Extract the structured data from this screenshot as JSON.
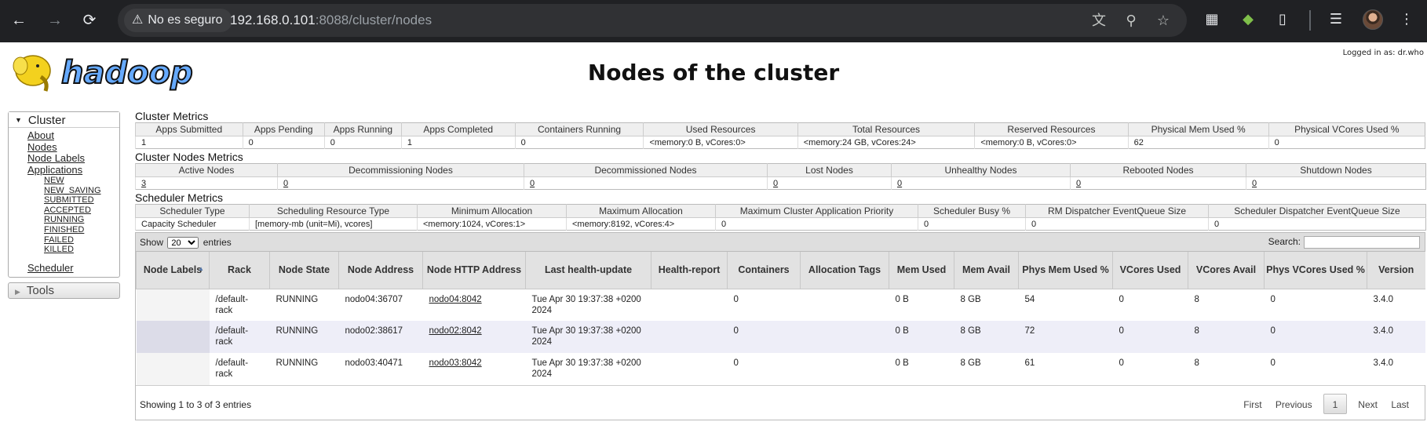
{
  "browser": {
    "security_label": "No es seguro",
    "url_host": "192.168.0.101",
    "url_rest": ":8088/cluster/nodes"
  },
  "header": {
    "logo_text": "hadoop",
    "title": "Nodes of the cluster",
    "logged_in": "Logged in as: dr.who"
  },
  "sidebar": {
    "cluster_label": "Cluster",
    "links": [
      "About",
      "Nodes",
      "Node Labels",
      "Applications"
    ],
    "app_states": [
      "NEW",
      "NEW_SAVING",
      "SUBMITTED",
      "ACCEPTED",
      "RUNNING",
      "FINISHED",
      "FAILED",
      "KILLED"
    ],
    "scheduler_label": "Scheduler",
    "tools_label": "Tools"
  },
  "cluster_metrics": {
    "title": "Cluster Metrics",
    "headers": [
      "Apps Submitted",
      "Apps Pending",
      "Apps Running",
      "Apps Completed",
      "Containers Running",
      "Used Resources",
      "Total Resources",
      "Reserved Resources",
      "Physical Mem Used %",
      "Physical VCores Used %"
    ],
    "values": [
      "1",
      "0",
      "0",
      "1",
      "0",
      "<memory:0 B, vCores:0>",
      "<memory:24 GB, vCores:24>",
      "<memory:0 B, vCores:0>",
      "62",
      "0"
    ]
  },
  "node_metrics": {
    "title": "Cluster Nodes Metrics",
    "headers": [
      "Active Nodes",
      "Decommissioning Nodes",
      "Decommissioned Nodes",
      "Lost Nodes",
      "Unhealthy Nodes",
      "Rebooted Nodes",
      "Shutdown Nodes"
    ],
    "values": [
      "3",
      "0",
      "0",
      "0",
      "0",
      "0",
      "0"
    ]
  },
  "scheduler_metrics": {
    "title": "Scheduler Metrics",
    "headers": [
      "Scheduler Type",
      "Scheduling Resource Type",
      "Minimum Allocation",
      "Maximum Allocation",
      "Maximum Cluster Application Priority",
      "Scheduler Busy %",
      "RM Dispatcher EventQueue Size",
      "Scheduler Dispatcher EventQueue Size"
    ],
    "values": [
      "Capacity Scheduler",
      "[memory-mb (unit=Mi), vcores]",
      "<memory:1024, vCores:1>",
      "<memory:8192, vCores:4>",
      "0",
      "0",
      "0",
      "0"
    ]
  },
  "nodes_table": {
    "show_label": "Show",
    "show_value": "20",
    "entries_label": "entries",
    "search_label": "Search:",
    "headers": [
      "Node Labels",
      "Rack",
      "Node State",
      "Node Address",
      "Node HTTP Address",
      "Last health-update",
      "Health-report",
      "Containers",
      "Allocation Tags",
      "Mem Used",
      "Mem Avail",
      "Phys Mem Used %",
      "VCores Used",
      "VCores Avail",
      "Phys VCores Used %",
      "Version"
    ],
    "rows": [
      [
        "",
        "/default-rack",
        "RUNNING",
        "nodo04:36707",
        "nodo04:8042",
        "Tue Apr 30 19:37:38 +0200 2024",
        "",
        "0",
        "",
        "0 B",
        "8 GB",
        "54",
        "0",
        "8",
        "0",
        "3.4.0"
      ],
      [
        "",
        "/default-rack",
        "RUNNING",
        "nodo02:38617",
        "nodo02:8042",
        "Tue Apr 30 19:37:38 +0200 2024",
        "",
        "0",
        "",
        "0 B",
        "8 GB",
        "72",
        "0",
        "8",
        "0",
        "3.4.0"
      ],
      [
        "",
        "/default-rack",
        "RUNNING",
        "nodo03:40471",
        "nodo03:8042",
        "Tue Apr 30 19:37:38 +0200 2024",
        "",
        "0",
        "",
        "0 B",
        "8 GB",
        "61",
        "0",
        "8",
        "0",
        "3.4.0"
      ]
    ],
    "info": "Showing 1 to 3 of 3 entries",
    "pager": {
      "first": "First",
      "previous": "Previous",
      "current": "1",
      "next": "Next",
      "last": "Last"
    }
  }
}
